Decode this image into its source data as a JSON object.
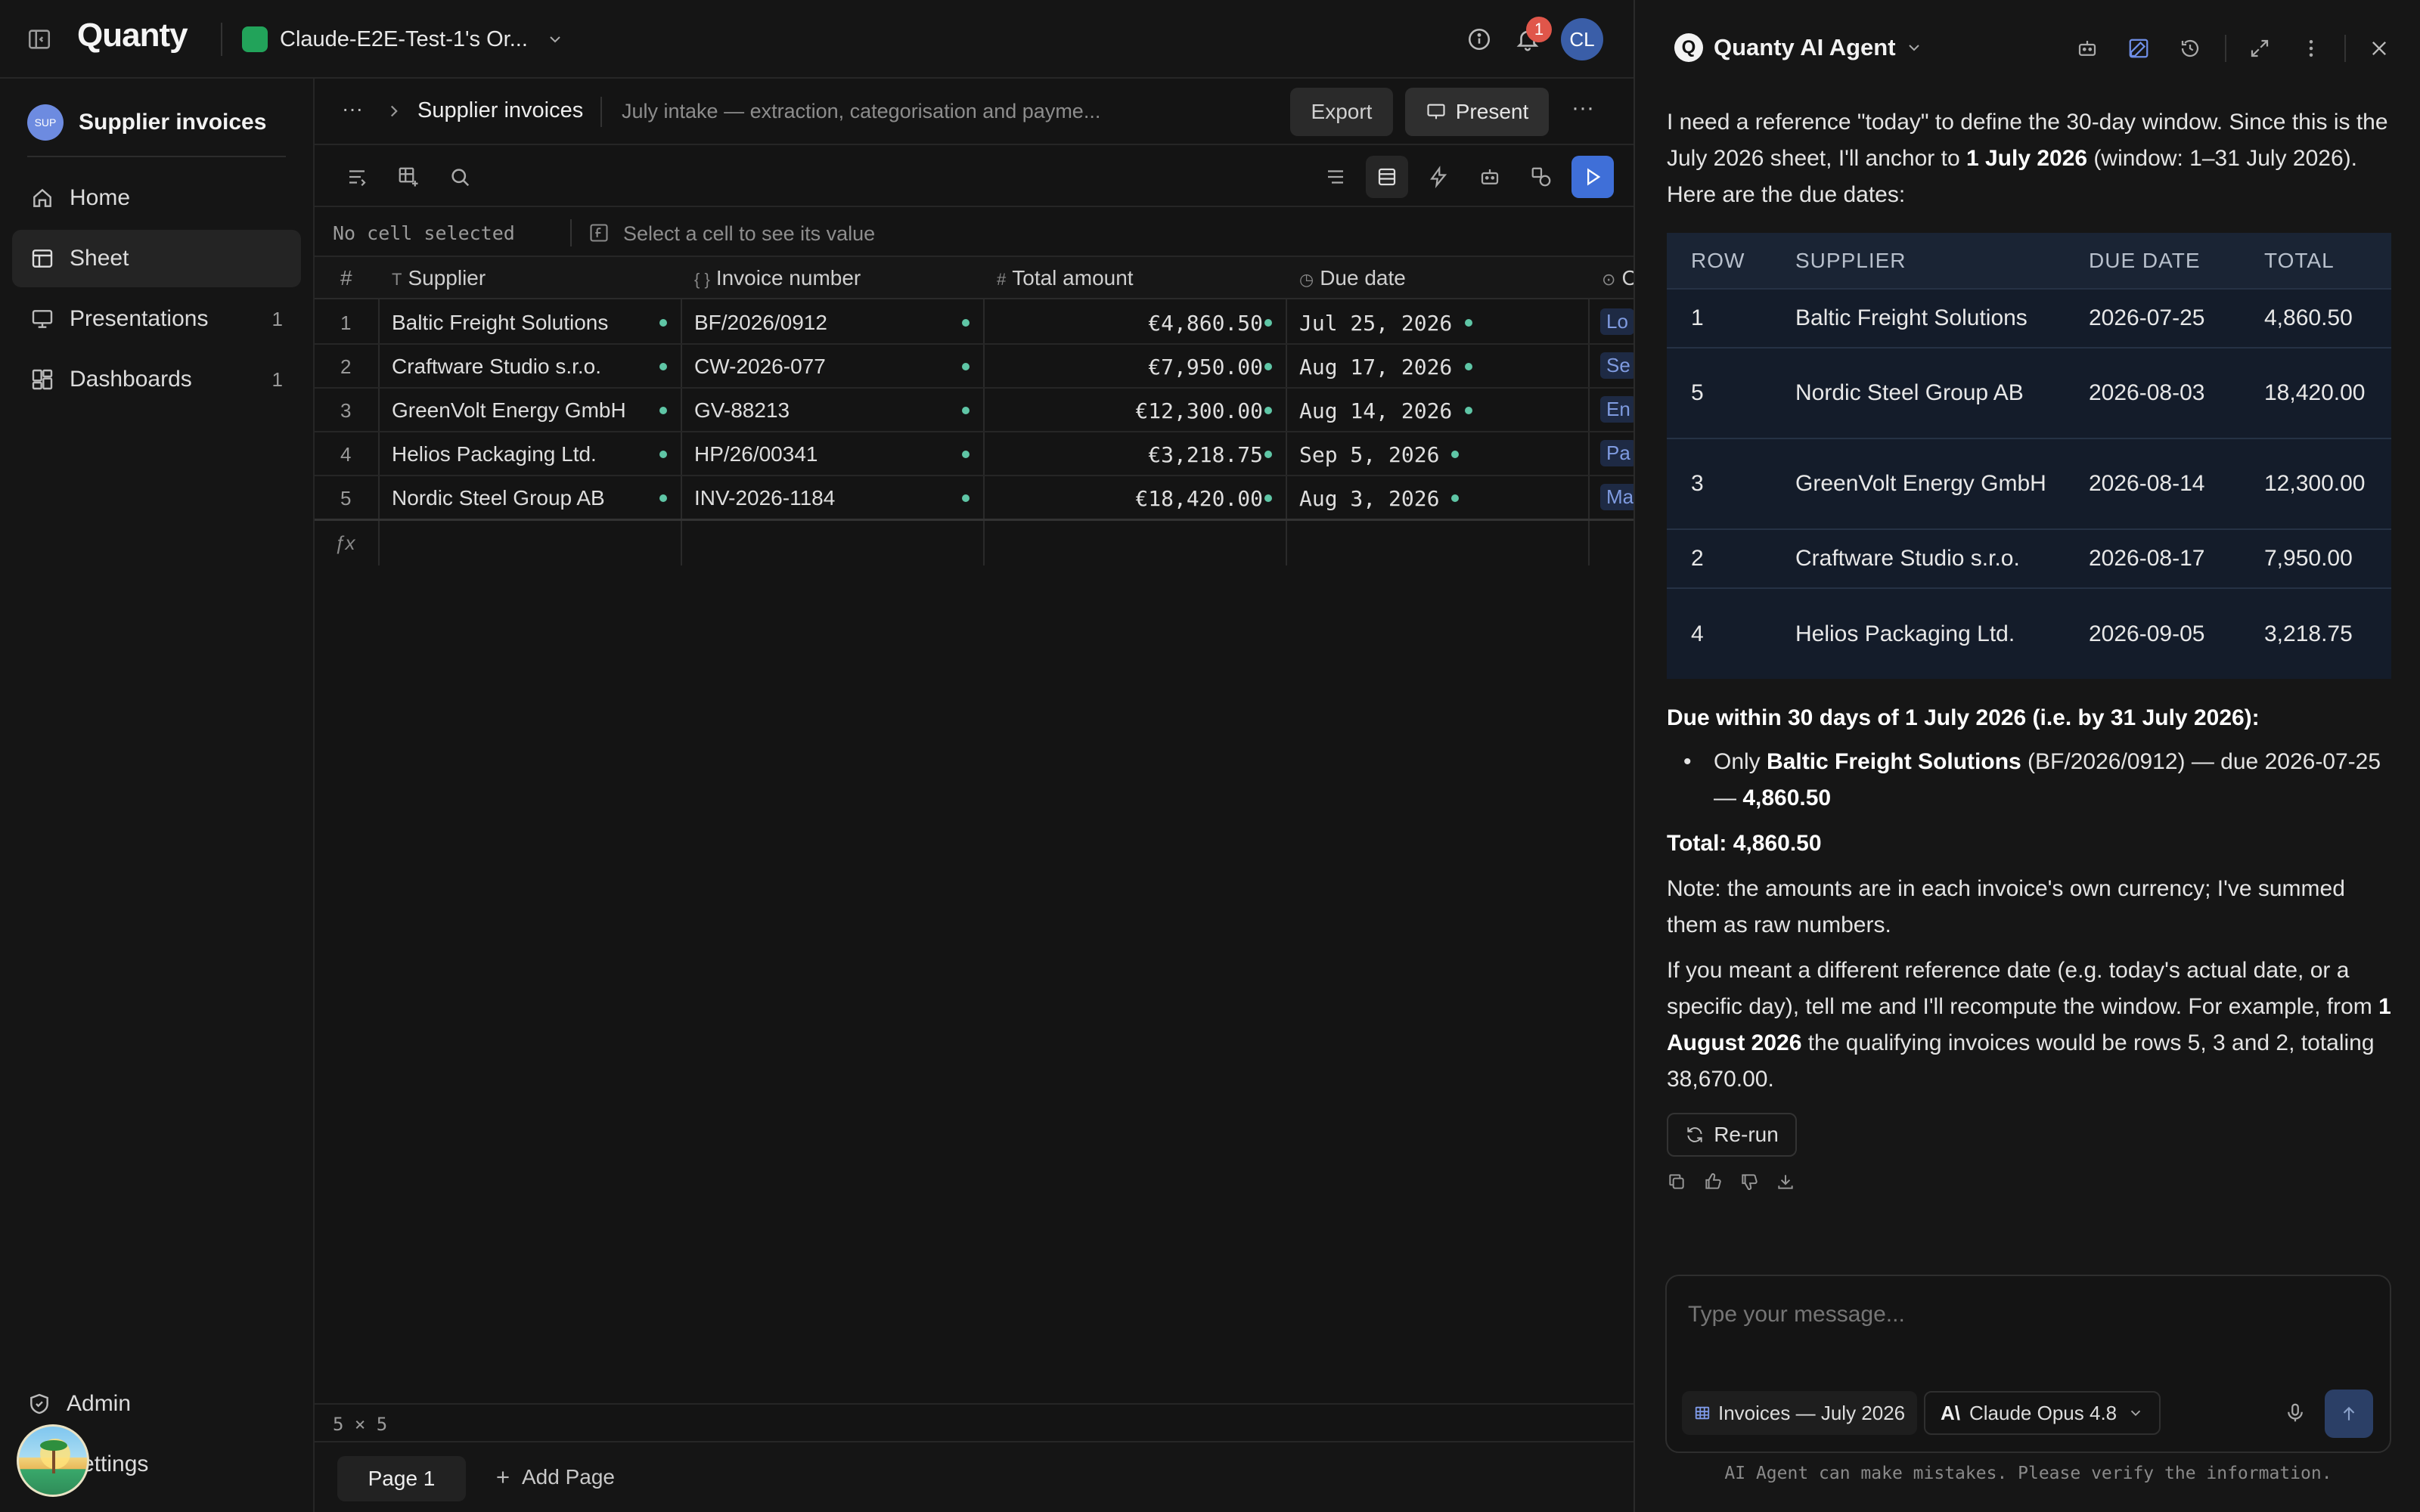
{
  "app": {
    "logo": "Quanty",
    "org_name": "Claude-E2E-Test-1's Or...",
    "org_color": "#22a35a",
    "notification_count": "1",
    "avatar_initials": "CL"
  },
  "sidebar": {
    "workspace_badge": "SUP",
    "workspace_name": "Supplier invoices",
    "items": [
      {
        "label": "Home",
        "icon": "home-icon",
        "count": ""
      },
      {
        "label": "Sheet",
        "icon": "sheet-icon",
        "count": ""
      },
      {
        "label": "Presentations",
        "icon": "presentation-icon",
        "count": "1"
      },
      {
        "label": "Dashboards",
        "icon": "dashboard-icon",
        "count": "1"
      }
    ],
    "bottom": {
      "admin": "Admin",
      "settings": "Settings"
    }
  },
  "main": {
    "breadcrumb_more": "···",
    "breadcrumb_title": "Supplier invoices",
    "description": "July intake — extraction, categorisation and payme...",
    "export_label": "Export",
    "present_label": "Present",
    "cell_ref": "No cell selected",
    "cell_value_placeholder": "Select a cell to see its value",
    "grid": {
      "row_header": "#",
      "columns": [
        {
          "type_icon": "T",
          "label": "Supplier"
        },
        {
          "type_icon": "{ }",
          "label": "Invoice number"
        },
        {
          "type_icon": "#",
          "label": "Total amount"
        },
        {
          "type_icon": "◷",
          "label": "Due date"
        },
        {
          "type_icon": "⊙",
          "label": "C"
        }
      ],
      "rows": [
        {
          "n": "1",
          "supplier": "Baltic Freight Solutions",
          "invoice": "BF/2026/0912",
          "total": "€4,860.50",
          "due": "Jul 25, 2026",
          "cat": "Lo"
        },
        {
          "n": "2",
          "supplier": "Craftware Studio s.r.o.",
          "invoice": "CW-2026-077",
          "total": "€7,950.00",
          "due": "Aug 17, 2026",
          "cat": "Se"
        },
        {
          "n": "3",
          "supplier": "GreenVolt Energy GmbH",
          "invoice": "GV-88213",
          "total": "€12,300.00",
          "due": "Aug 14, 2026",
          "cat": "En"
        },
        {
          "n": "4",
          "supplier": "Helios Packaging Ltd.",
          "invoice": "HP/26/00341",
          "total": "€3,218.75",
          "due": "Sep 5, 2026",
          "cat": "Pa"
        },
        {
          "n": "5",
          "supplier": "Nordic Steel Group AB",
          "invoice": "INV-2026-1184",
          "total": "€18,420.00",
          "due": "Aug 3, 2026",
          "cat": "Ma"
        }
      ],
      "formula_icon": "ƒx",
      "dimensions": "5 × 5"
    },
    "pages": {
      "current": "Page 1",
      "add": "Add Page"
    }
  },
  "agent": {
    "title": "Quanty AI Agent",
    "intro_1": "I need a reference \"today\" to define the 30-day window. Since this is the July 2026 sheet, I'll anchor to ",
    "intro_bold": "1 July 2026",
    "intro_2": " (window: 1–31 July 2026). Here are the due dates:",
    "table": {
      "headers": [
        "ROW",
        "SUPPLIER",
        "DUE DATE",
        "TOTAL"
      ],
      "rows": [
        [
          "1",
          "Baltic Freight Solutions",
          "2026-07-25",
          "4,860.50"
        ],
        [
          "5",
          "Nordic Steel Group AB",
          "2026-08-03",
          "18,420.00"
        ],
        [
          "3",
          "GreenVolt Energy GmbH",
          "2026-08-14",
          "12,300.00"
        ],
        [
          "2",
          "Craftware Studio s.r.o.",
          "2026-08-17",
          "7,950.00"
        ],
        [
          "4",
          "Helios Packaging Ltd.",
          "2026-09-05",
          "3,218.75"
        ]
      ]
    },
    "due_heading": "Due within 30 days of 1 July 2026 (i.e. by 31 July 2026):",
    "bullet_pre": "Only ",
    "bullet_bold": "Baltic Freight Solutions",
    "bullet_mid": " (BF/2026/0912) — due 2026-07-25 — ",
    "bullet_amount": "4,860.50",
    "total_line": "Total: 4,860.50",
    "note": "Note: the amounts are in each invoice's own currency; I've summed them as raw numbers.",
    "followup_1": "If you meant a different reference date (e.g. today's actual date, or a specific day), tell me and I'll recompute the window. For example, from ",
    "followup_bold": "1 August 2026",
    "followup_2": " the qualifying invoices would be rows 5, 3 and 2, totaling 38,670.00.",
    "rerun_label": "Re-run",
    "input_placeholder": "Type your message...",
    "context_chip": "Invoices — July 2026",
    "model": "Claude Opus 4.8",
    "disclaimer": "AI Agent can make mistakes. Please verify the information."
  },
  "colors": {
    "accent": "#3f6fd8",
    "status_dot": "#5fc6a6",
    "badge_red": "#e0564a"
  }
}
